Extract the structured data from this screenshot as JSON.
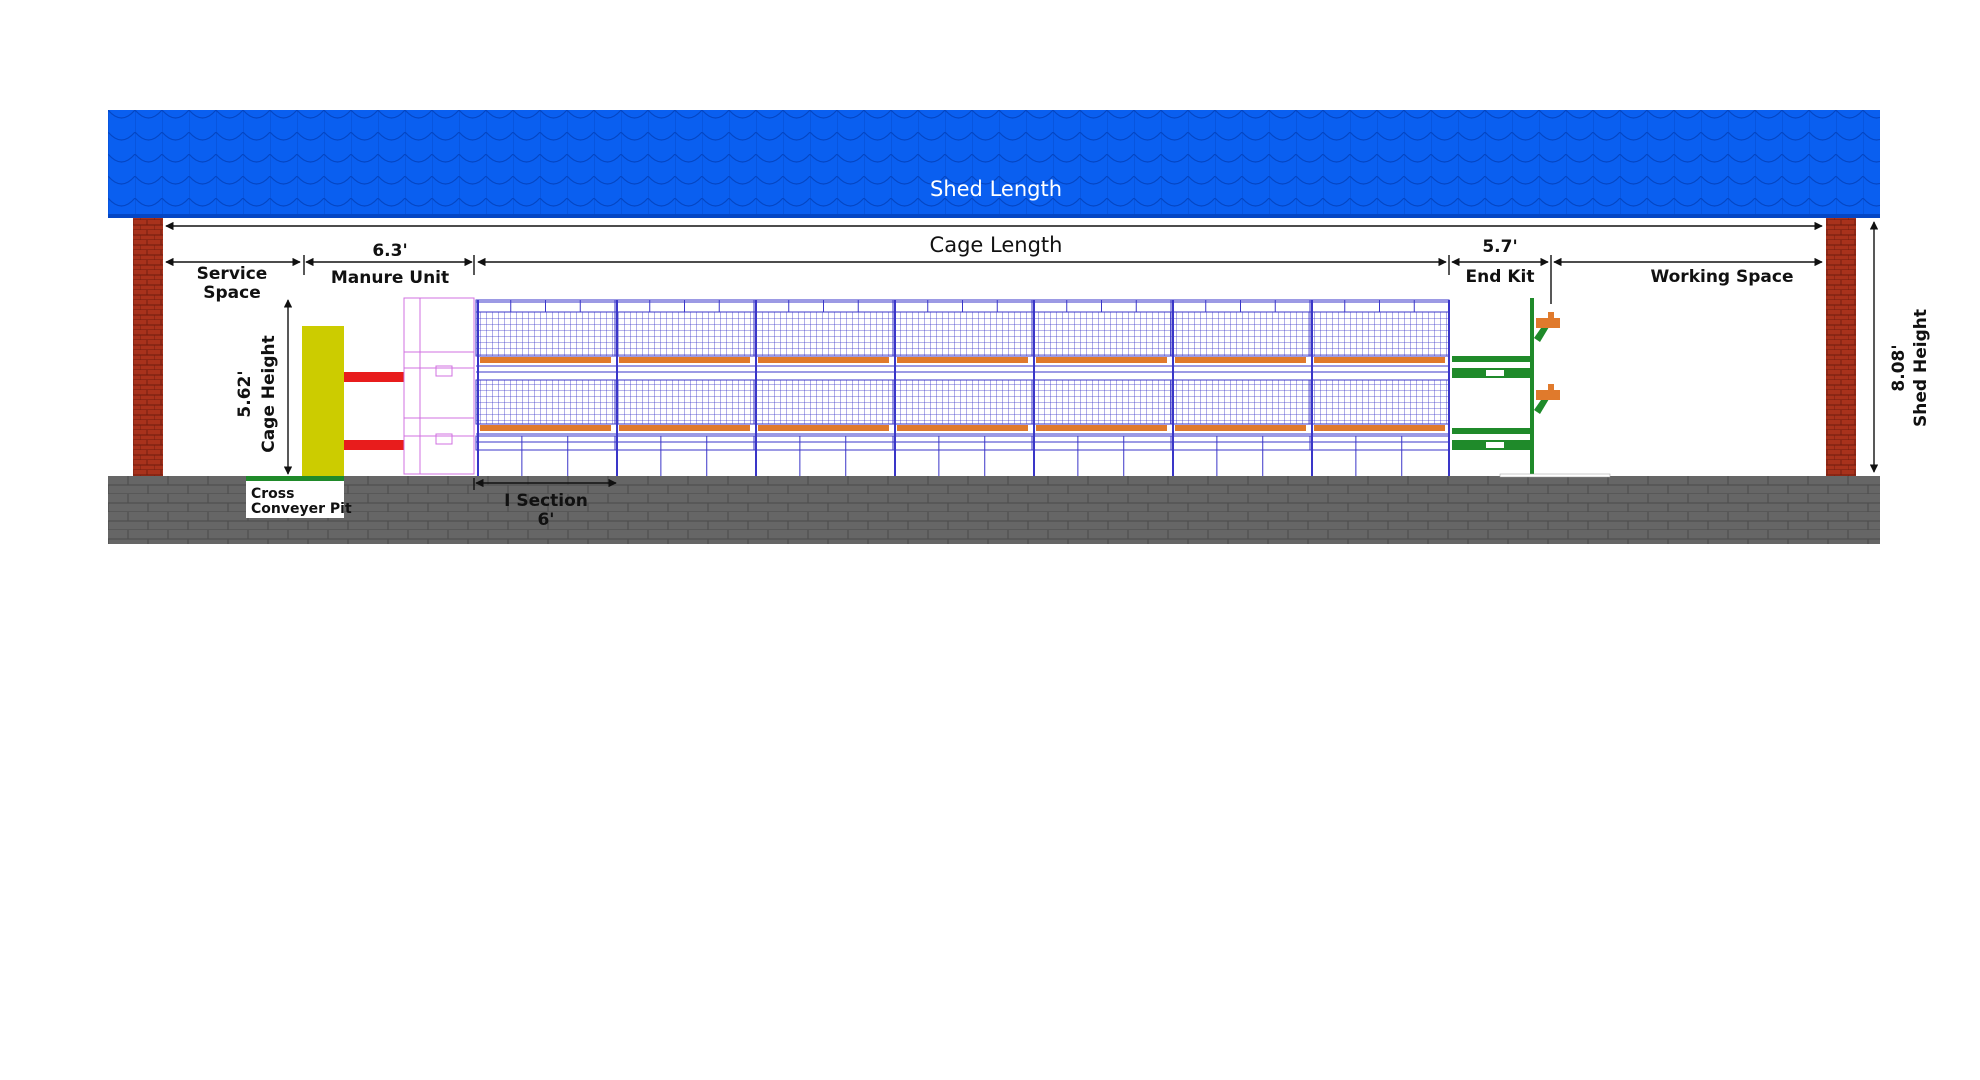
{
  "labels": {
    "shed_length": "Shed Length",
    "cage_length": "Cage Length",
    "manure_unit_value": "6.3'",
    "manure_unit": "Manure Unit",
    "service_space_line1": "Service",
    "service_space_line2": "Space",
    "end_kit_value": "5.7'",
    "end_kit": "End Kit",
    "working_space": "Working Space",
    "cage_height_value": "5.62'",
    "cage_height": "Cage Height",
    "shed_height_value": "8.08'",
    "shed_height": "Shed Height",
    "i_section": "I Section",
    "i_section_value": "6'",
    "cross_conveyor_line1": "Cross",
    "cross_conveyor_line2": "Conveyer Pit"
  },
  "colors": {
    "roof": "#0a5ff0",
    "roof_scale": "#0446c4",
    "pillar": "#a8321c",
    "pillar_brick": "#6e1c0e",
    "ground": "#666666",
    "ground_brick": "#4f4f4f",
    "cage_wire": "#3a36c8",
    "feeder_trough": "#e07a2c",
    "manure_unit_box": "#cccc00",
    "manure_pipe": "#e81c1c",
    "manure_frame": "#d070e0",
    "end_kit": "#1f8a2a",
    "end_kit_accent": "#e07a2c",
    "conveyor_pit": "#1f8a2a",
    "dimension_line": "#111111"
  }
}
